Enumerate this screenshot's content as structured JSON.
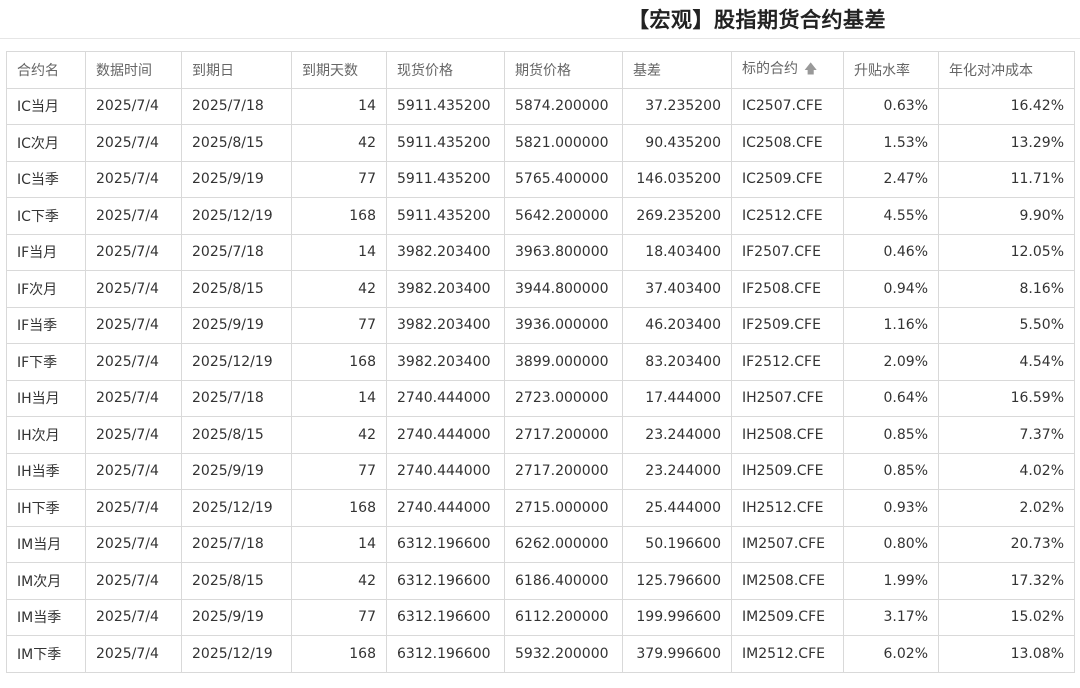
{
  "title": "【宏观】股指期货合约基差",
  "table": {
    "columns": [
      "合约名",
      "数据时间",
      "到期日",
      "到期天数",
      "现货价格",
      "期货价格",
      "基差",
      "标的合约",
      "升贴水率",
      "年化对冲成本"
    ],
    "sort_column": "标的合约",
    "sort_icon": "sort-ascending-arrow-icon",
    "rows": [
      [
        "IC当月",
        "2025/7/4",
        "2025/7/18",
        "14",
        "5911.435200",
        "5874.200000",
        "37.235200",
        "IC2507.CFE",
        "0.63%",
        "16.42%"
      ],
      [
        "IC次月",
        "2025/7/4",
        "2025/8/15",
        "42",
        "5911.435200",
        "5821.000000",
        "90.435200",
        "IC2508.CFE",
        "1.53%",
        "13.29%"
      ],
      [
        "IC当季",
        "2025/7/4",
        "2025/9/19",
        "77",
        "5911.435200",
        "5765.400000",
        "146.035200",
        "IC2509.CFE",
        "2.47%",
        "11.71%"
      ],
      [
        "IC下季",
        "2025/7/4",
        "2025/12/19",
        "168",
        "5911.435200",
        "5642.200000",
        "269.235200",
        "IC2512.CFE",
        "4.55%",
        "9.90%"
      ],
      [
        "IF当月",
        "2025/7/4",
        "2025/7/18",
        "14",
        "3982.203400",
        "3963.800000",
        "18.403400",
        "IF2507.CFE",
        "0.46%",
        "12.05%"
      ],
      [
        "IF次月",
        "2025/7/4",
        "2025/8/15",
        "42",
        "3982.203400",
        "3944.800000",
        "37.403400",
        "IF2508.CFE",
        "0.94%",
        "8.16%"
      ],
      [
        "IF当季",
        "2025/7/4",
        "2025/9/19",
        "77",
        "3982.203400",
        "3936.000000",
        "46.203400",
        "IF2509.CFE",
        "1.16%",
        "5.50%"
      ],
      [
        "IF下季",
        "2025/7/4",
        "2025/12/19",
        "168",
        "3982.203400",
        "3899.000000",
        "83.203400",
        "IF2512.CFE",
        "2.09%",
        "4.54%"
      ],
      [
        "IH当月",
        "2025/7/4",
        "2025/7/18",
        "14",
        "2740.444000",
        "2723.000000",
        "17.444000",
        "IH2507.CFE",
        "0.64%",
        "16.59%"
      ],
      [
        "IH次月",
        "2025/7/4",
        "2025/8/15",
        "42",
        "2740.444000",
        "2717.200000",
        "23.244000",
        "IH2508.CFE",
        "0.85%",
        "7.37%"
      ],
      [
        "IH当季",
        "2025/7/4",
        "2025/9/19",
        "77",
        "2740.444000",
        "2717.200000",
        "23.244000",
        "IH2509.CFE",
        "0.85%",
        "4.02%"
      ],
      [
        "IH下季",
        "2025/7/4",
        "2025/12/19",
        "168",
        "2740.444000",
        "2715.000000",
        "25.444000",
        "IH2512.CFE",
        "0.93%",
        "2.02%"
      ],
      [
        "IM当月",
        "2025/7/4",
        "2025/7/18",
        "14",
        "6312.196600",
        "6262.000000",
        "50.196600",
        "IM2507.CFE",
        "0.80%",
        "20.73%"
      ],
      [
        "IM次月",
        "2025/7/4",
        "2025/8/15",
        "42",
        "6312.196600",
        "6186.400000",
        "125.796600",
        "IM2508.CFE",
        "1.99%",
        "17.32%"
      ],
      [
        "IM当季",
        "2025/7/4",
        "2025/9/19",
        "77",
        "6312.196600",
        "6112.200000",
        "199.996600",
        "IM2509.CFE",
        "3.17%",
        "15.02%"
      ],
      [
        "IM下季",
        "2025/7/4",
        "2025/12/19",
        "168",
        "6312.196600",
        "5932.200000",
        "379.996600",
        "IM2512.CFE",
        "6.02%",
        "13.08%"
      ]
    ]
  }
}
